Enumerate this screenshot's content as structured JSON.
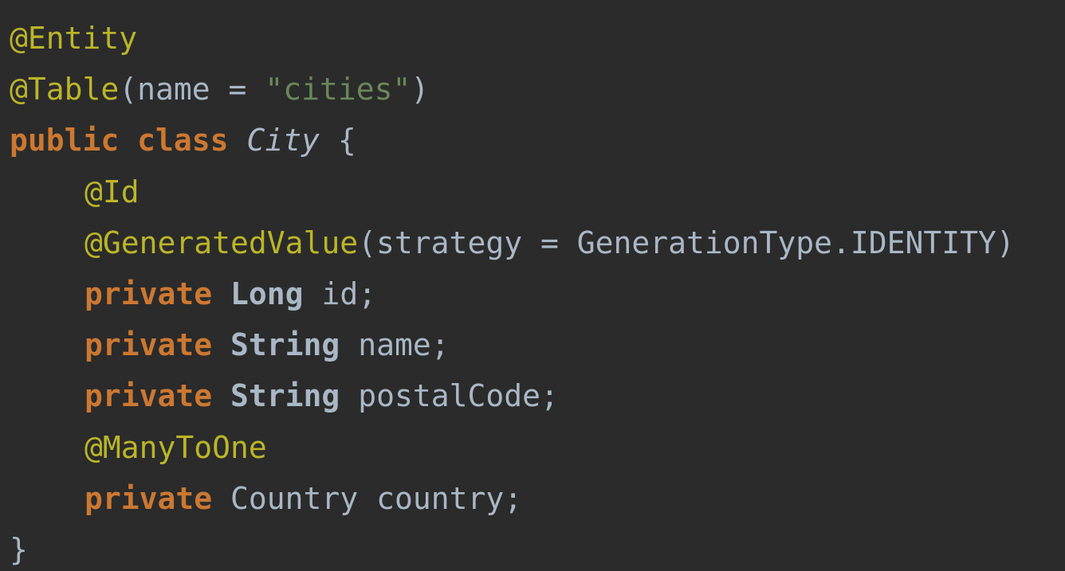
{
  "code": {
    "line1": {
      "annotation": "@Entity"
    },
    "line2": {
      "annotation": "@Table",
      "open": "(name = ",
      "string": "\"cities\"",
      "close": ")"
    },
    "line3": {
      "kw1": "public",
      "kw2": "class",
      "classname": "City",
      "brace": "{"
    },
    "line4": {
      "annotation": "@Id"
    },
    "line5": {
      "annotation": "@GeneratedValue",
      "rest": "(strategy = GenerationType.IDENTITY)"
    },
    "line6": {
      "kw": "private",
      "type": "Long",
      "rest": "id;"
    },
    "line7": {
      "kw": "private",
      "type": "String",
      "rest": "name;"
    },
    "line8": {
      "kw": "private",
      "type": "String",
      "rest": "postalCode;"
    },
    "line9": {
      "annotation": "@ManyToOne"
    },
    "line10": {
      "kw": "private",
      "type": "Country",
      "rest": "country;"
    },
    "line11": {
      "brace": "}"
    }
  },
  "colors": {
    "background": "#2b2b2b",
    "annotation": "#bbb529",
    "keyword": "#cc7832",
    "string": "#6a8759",
    "default": "#a9b7c6"
  }
}
